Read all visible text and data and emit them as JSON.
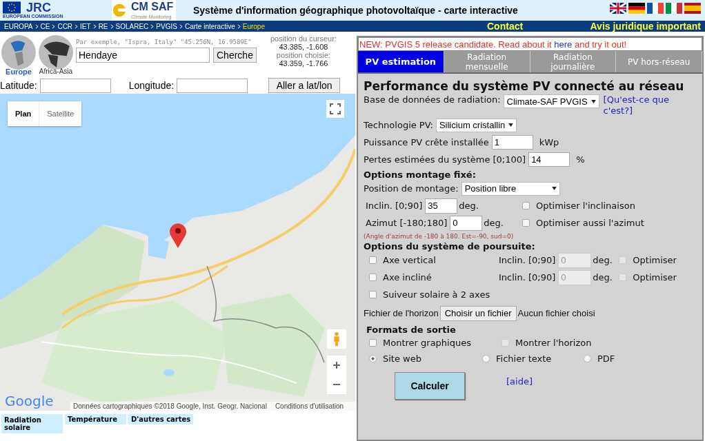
{
  "header": {
    "logo_text": "JRC",
    "logo_subtext": "EUROPEAN COMMISSION",
    "partner": "CM SAF",
    "partner_sub": "Climate Monitoring",
    "title": "Système d'information géographique photovoltaïque - carte interactive"
  },
  "breadcrumb": {
    "items": [
      "EUROPA",
      "CE",
      "CCR",
      "IET",
      "RE",
      "SOLAREC",
      "PVGIS",
      "Carte interactive"
    ],
    "current": "Europe",
    "links": [
      "Contact",
      "Avis juridique important"
    ]
  },
  "regions": [
    {
      "label": "Europe",
      "selected": true
    },
    {
      "label": "Africa-Asia",
      "selected": false
    }
  ],
  "search": {
    "hint": "Par exemple, \"Ispra, Italy\" \"45.256N, 16.9589E\"",
    "value": "Hendaye",
    "button": "Cherche"
  },
  "cursor": {
    "label": "position du curseur:",
    "value": "43.385, -1.608"
  },
  "chosen": {
    "label": "position choisie:",
    "value": "43.359, -1.766"
  },
  "latlon": {
    "lat_label": "Latitude:",
    "lon_label": "Longitude:",
    "button": "Aller a lat/lon"
  },
  "map": {
    "types": [
      {
        "label": "Plan",
        "selected": true
      },
      {
        "label": "Satellite",
        "selected": false
      }
    ],
    "logo": "Google",
    "attribution": "Données cartographiques ©2018 Google, Inst. Geogr. Nacional",
    "terms": "Conditions d'utilisation"
  },
  "map_tabs": [
    "Radiation solaire",
    "Température",
    "D'autres cartes"
  ],
  "notice": {
    "before": "NEW: PVGIS 5 release candidate. Read about it ",
    "link": "here",
    "after": " and try it out!"
  },
  "tabs": [
    {
      "label": "PV estimation",
      "selected": true
    },
    {
      "label": "Radiation mensuelle",
      "selected": false
    },
    {
      "label": "Radiation journalière",
      "selected": false
    },
    {
      "label": "PV hors-réseau",
      "selected": false
    }
  ],
  "form": {
    "title": "Performance du système PV connecté au réseau",
    "database": {
      "label": "Base de données de radiation:",
      "value": "Climate-SAF PVGIS",
      "help": "[Qu'est-ce que c'est?]"
    },
    "technology": {
      "label": "Technologie PV:",
      "value": "Silicium cristallin"
    },
    "peak_power": {
      "label": "Puissance PV crête installée",
      "value": "1",
      "unit": "kWp"
    },
    "losses": {
      "label": "Pertes estimées du système [0;100]",
      "value": "14",
      "unit": "%"
    },
    "fixed_heading": "Options montage fixé:",
    "mounting": {
      "label": "Position de montage:",
      "value": "Position libre"
    },
    "angles": [
      {
        "label": "Inclin. [0;90]",
        "value": "35",
        "unit": "deg.",
        "optimise": {
          "label": "Optimiser l'inclinaison",
          "checked": false
        }
      },
      {
        "label": "Azimut [-180;180]",
        "value": "0",
        "unit": "deg.",
        "optimise": {
          "label": "Optimiser aussi l'azimut",
          "checked": false
        }
      }
    ],
    "azimuth_note": "(Angle d'azimut de -180 à 180. Est=-90, sud=0)",
    "tracking_heading": "Options du système de poursuite:",
    "tracking": [
      {
        "label": "Axe vertical",
        "checked": false,
        "slope": {
          "label": "Inclin. [0;90]",
          "value": "0",
          "unit": "deg.",
          "disabled": true
        },
        "optimise": {
          "label": "Optimiser",
          "checked": false,
          "disabled": true
        }
      },
      {
        "label": "Axe incliné",
        "checked": false,
        "slope": {
          "label": "Inclin. [0;90]",
          "value": "0",
          "unit": "deg.",
          "disabled": true
        },
        "optimise": {
          "label": "Optimiser",
          "checked": false,
          "disabled": true
        }
      },
      {
        "label": "Suiveur solaire à 2 axes",
        "checked": false
      }
    ],
    "horizon": {
      "label": "Fichier de l'horizon",
      "button": "Choisir un fichier",
      "status": "Aucun fichier choisi"
    },
    "output_heading": "Formats de sortie",
    "output_options": [
      {
        "label": "Montrer graphiques",
        "checked": false,
        "disabled": false
      },
      {
        "label": "Montrer l'horizon",
        "checked": false,
        "disabled": true
      }
    ],
    "output_formats": [
      {
        "label": "Site web",
        "selected": true
      },
      {
        "label": "Fichier texte",
        "selected": false
      },
      {
        "label": "PDF",
        "selected": false
      }
    ],
    "submit": "Calculer",
    "help": "[aide]"
  }
}
